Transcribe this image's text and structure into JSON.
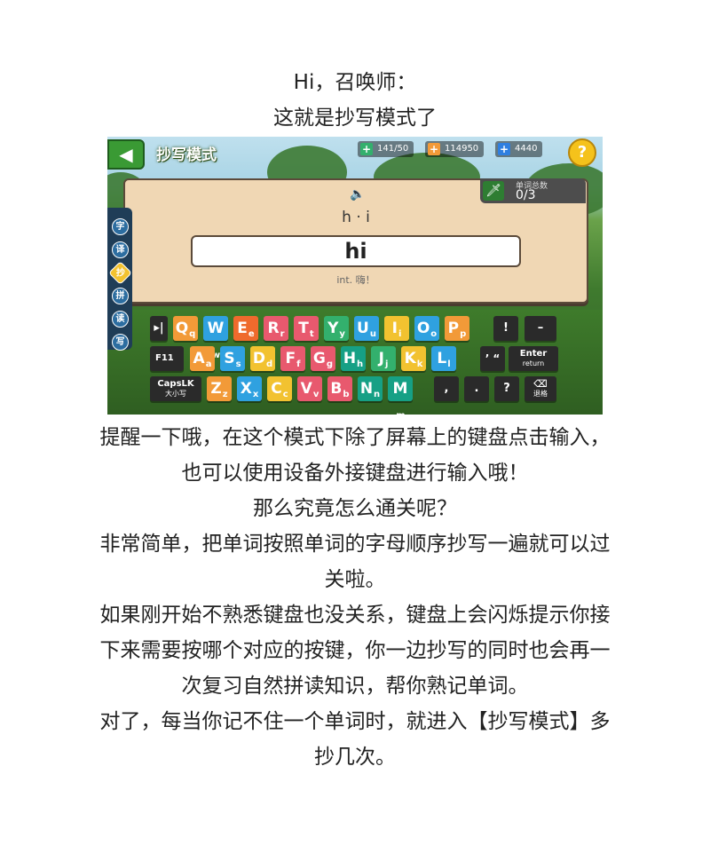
{
  "intro": {
    "line1": "Hi，召唤师：",
    "line2": "这就是抄写模式了"
  },
  "game": {
    "back_icon": "◀",
    "mode_title": "抄写模式",
    "stats": {
      "energy": "141/50",
      "coins": "114950",
      "gems": "4440"
    },
    "help": "?",
    "counter_label": "单词总数",
    "counter_value": "0/3",
    "syllables": "h · i",
    "answer": "hi",
    "meaning": "int. 嗨！",
    "side_tabs": [
      "字",
      "译",
      "抄",
      "拼",
      "读",
      "写"
    ],
    "keyboard": {
      "row1": [
        {
          "m": "Q",
          "s": "q",
          "color": "#f29a38"
        },
        {
          "m": "W",
          "s": "w",
          "color": "#2fa1e0"
        },
        {
          "m": "E",
          "s": "e",
          "color": "#ef6a2d"
        },
        {
          "m": "R",
          "s": "r",
          "color": "#e8596e"
        },
        {
          "m": "T",
          "s": "t",
          "color": "#e8596e"
        },
        {
          "m": "Y",
          "s": "y",
          "color": "#33b06d"
        },
        {
          "m": "U",
          "s": "u",
          "color": "#2fa1e0"
        },
        {
          "m": "I",
          "s": "i",
          "color": "#f2c230"
        },
        {
          "m": "O",
          "s": "o",
          "color": "#2fa1e0"
        },
        {
          "m": "P",
          "s": "p",
          "color": "#f29a38"
        }
      ],
      "row2": [
        {
          "m": "A",
          "s": "a",
          "color": "#f29a38"
        },
        {
          "m": "S",
          "s": "s",
          "color": "#2fa1e0"
        },
        {
          "m": "D",
          "s": "d",
          "color": "#f2c230"
        },
        {
          "m": "F",
          "s": "f",
          "color": "#e8596e"
        },
        {
          "m": "G",
          "s": "g",
          "color": "#e8596e"
        },
        {
          "m": "H",
          "s": "h",
          "color": "#16a085"
        },
        {
          "m": "J",
          "s": "j",
          "color": "#33b06d"
        },
        {
          "m": "K",
          "s": "k",
          "color": "#f2c230"
        },
        {
          "m": "L",
          "s": "l",
          "color": "#2fa1e0"
        }
      ],
      "row3": [
        {
          "m": "Z",
          "s": "z",
          "color": "#f29a38"
        },
        {
          "m": "X",
          "s": "x",
          "color": "#2fa1e0"
        },
        {
          "m": "C",
          "s": "c",
          "color": "#f2c230"
        },
        {
          "m": "V",
          "s": "v",
          "color": "#e8596e"
        },
        {
          "m": "B",
          "s": "b",
          "color": "#e8596e"
        },
        {
          "m": "N",
          "s": "n",
          "color": "#16a085"
        },
        {
          "m": "M",
          "s": "m",
          "color": "#16a085"
        }
      ],
      "tab": "▸|",
      "f11": "F11",
      "caps": "CapsLK",
      "caps_sub": "大小写",
      "bang": "!",
      "dash": "–",
      "quote": "’ “",
      "enter": "Enter",
      "enter_sub": "return",
      "comma": ",",
      "period": ".",
      "question": "?",
      "backspace": "⌫",
      "backspace_sub": "退格"
    }
  },
  "body": {
    "p1": "提醒一下哦，在这个模式下除了屏幕上的键盘点击输入，也可以使用设备外接键盘进行输入哦！",
    "p2": "那么究竟怎么通关呢？",
    "p3": "非常简单，把单词按照单词的字母顺序抄写一遍就可以过关啦。",
    "p4": "如果刚开始不熟悉键盘也没关系，键盘上会闪烁提示你接下来需要按哪个对应的按键，你一边抄写的同时也会再一次复习自然拼读知识，帮你熟记单词。",
    "p5": "对了，每当你记不住一个单词时，就进入【抄写模式】多抄几次。"
  }
}
